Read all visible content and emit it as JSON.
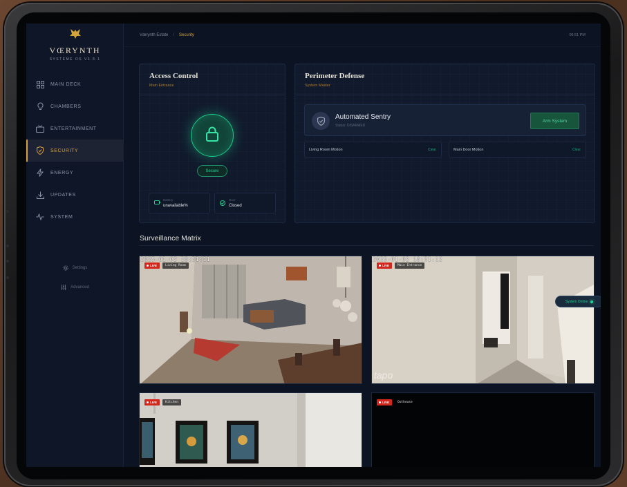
{
  "brand": {
    "name": "VŒRYNTH",
    "version": "SYSTÈME OS V3.8.1"
  },
  "sidebar": {
    "items": [
      {
        "label": "MAIN DECK",
        "icon": "grid-icon",
        "active": false
      },
      {
        "label": "CHAMBERS",
        "icon": "bulb-icon",
        "active": false
      },
      {
        "label": "ENTERTAINMENT",
        "icon": "tv-icon",
        "active": false
      },
      {
        "label": "SECURITY",
        "icon": "shield-icon",
        "active": true
      },
      {
        "label": "ENERGY",
        "icon": "bolt-icon",
        "active": false
      },
      {
        "label": "UPDATES",
        "icon": "download-icon",
        "active": false
      },
      {
        "label": "SYSTEM",
        "icon": "activity-icon",
        "active": false
      }
    ],
    "settings_label": "Settings",
    "advanced_label": "Advanced"
  },
  "header": {
    "crumb_root": "Værynth Estate",
    "crumb_sep": "/",
    "crumb_current": "Security",
    "time": "06:51 PM"
  },
  "access": {
    "title": "Access Control",
    "subtitle": "Main Entrance",
    "state": "Secure",
    "battery_label": "Battery",
    "battery_value": "unavailable%",
    "door_label": "Door",
    "door_value": "Closed"
  },
  "perimeter": {
    "title": "Perimeter Defense",
    "subtitle": "System Master",
    "sentry_title": "Automated Sentry",
    "sentry_status": "Status: DISARMED",
    "arm_label": "Arm System",
    "motions": [
      {
        "label": "Living Room Motion",
        "action": "Clear"
      },
      {
        "label": "Main Door Motion",
        "action": "Clear"
      }
    ]
  },
  "surveillance": {
    "title": "Surveillance Matrix",
    "live_label": "LIVE",
    "status_label": "System Online",
    "cameras": [
      {
        "name": "Living Room",
        "timestamp": "2025-01-02 18:51:11"
      },
      {
        "name": "Main Entrance",
        "timestamp": "2025-01-02 18:51:12",
        "watermark": "tapo"
      },
      {
        "name": "Kitchen"
      },
      {
        "name": "Outhouse"
      }
    ]
  },
  "colors": {
    "accent": "#d9a441",
    "success": "#27d193",
    "live": "#d5261d",
    "background": "#0c1322"
  }
}
